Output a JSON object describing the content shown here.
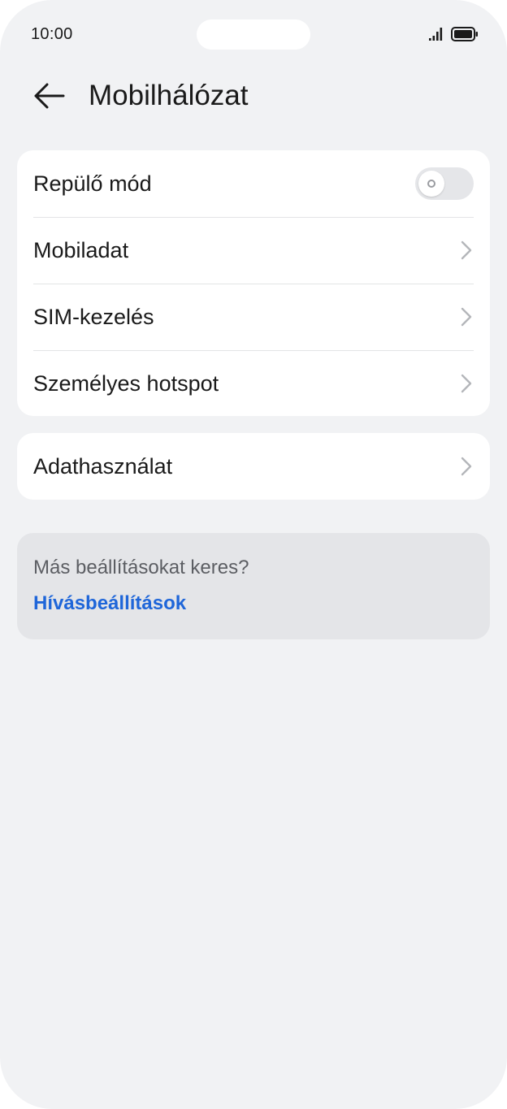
{
  "status_bar": {
    "time": "10:00",
    "signal_icon": "signal-bars-icon",
    "battery_icon": "battery-full-icon"
  },
  "header": {
    "back_icon": "arrow-left-icon",
    "title": "Mobilhálózat"
  },
  "settings": {
    "airplane_mode": {
      "label": "Repülő mód",
      "enabled": false
    },
    "mobile_data": {
      "label": "Mobiladat",
      "icon": "chevron-right-icon"
    },
    "sim_management": {
      "label": "SIM-kezelés",
      "icon": "chevron-right-icon"
    },
    "personal_hotspot": {
      "label": "Személyes hotspot",
      "icon": "chevron-right-icon"
    }
  },
  "data_usage": {
    "label": "Adathasználat",
    "icon": "chevron-right-icon"
  },
  "suggestion": {
    "text": "Más beállításokat keres?",
    "link": "Hívásbeállítások"
  },
  "colors": {
    "background": "#f1f2f4",
    "card": "#ffffff",
    "suggestion_card": "#e4e5e8",
    "link": "#1f66d9",
    "toggle_off": "#e5e6e9"
  }
}
